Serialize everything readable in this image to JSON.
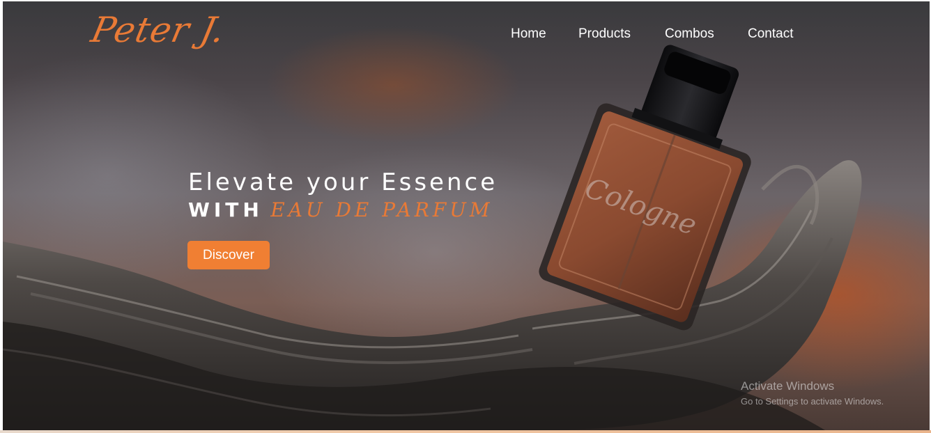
{
  "brand": {
    "logo_text": "Peter J."
  },
  "nav": {
    "items": [
      {
        "label": "Home"
      },
      {
        "label": "Products"
      },
      {
        "label": "Combos"
      },
      {
        "label": "Contact"
      }
    ]
  },
  "hero": {
    "title": "Elevate your Essence",
    "subtitle_prefix": "WITH",
    "subtitle_accent": "EAU DE PARFUM",
    "cta_label": "Discover",
    "bottle_label": "Cologne",
    "image_subject": "perfume-bottle-on-driftwood"
  },
  "watermark": {
    "title": "Activate Windows",
    "subtitle": "Go to Settings to activate Windows."
  },
  "colors": {
    "accent": "#f07f33",
    "logo": "#e97a36",
    "nav_text": "#ffffff"
  }
}
